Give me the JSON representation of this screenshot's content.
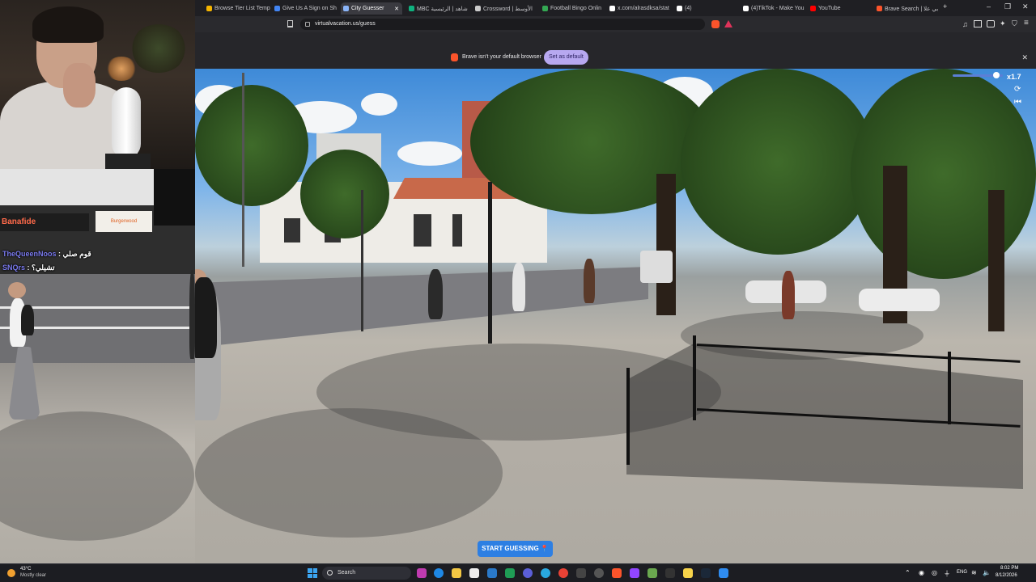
{
  "browser": {
    "tabs": [
      {
        "title": "Browse Tier List Temp",
        "favicon_color": "#f4b400"
      },
      {
        "title": "Give Us A Sign on Sh",
        "favicon_color": "#4285f4"
      },
      {
        "title": "City Guesser",
        "favicon_color": "#8ab4f8",
        "active": true
      },
      {
        "title": "MBC شاهد | الرئيسية",
        "favicon_color": "#0fb27f"
      },
      {
        "title": "Crossword | الأوسط",
        "favicon_color": "#cccccc"
      },
      {
        "title": "Football Bingo Onlin",
        "favicon_color": "#34a853"
      },
      {
        "title": "x.com/alrasdksa/stat",
        "favicon_color": "#ffffff"
      },
      {
        "title": "(4)",
        "favicon_color": "#ffffff"
      },
      {
        "title": "(4)TikTok - Make You",
        "favicon_color": "#ffffff"
      },
      {
        "title": "YouTube",
        "favicon_color": "#ff0000"
      },
      {
        "title": "Brave Search | بي علا",
        "favicon_color": "#fb542b"
      }
    ],
    "url": "virtualvacation.us/guess",
    "new_tab_symbol": "+",
    "window_controls": {
      "minimize": "–",
      "maximize": "❐",
      "close": "✕"
    }
  },
  "notice": {
    "text": "Brave isn't your default browser",
    "button": "Set as default",
    "close": "✕"
  },
  "viewer": {
    "speed_label": "x1.7",
    "speed_level": 0.8,
    "start_button": "START GUESSING 📍"
  },
  "chat": [
    {
      "user": "TheQueenNoos",
      "message": ": قوم صلي"
    },
    {
      "user": "SNQrs",
      "message": ": تشيلي؟"
    }
  ],
  "scene_signs": {
    "shop_left": "Banafide",
    "shop_right": "Burgerwood"
  },
  "taskbar": {
    "weather_temp": "43°C",
    "weather_desc": "Mostly clear",
    "search": "Search",
    "lang": "ENG",
    "time": "8:02 PM",
    "date": "8/12/2026"
  },
  "colors": {
    "accent_blue": "#2d7fe3",
    "set_default_bg": "#b7a8f0",
    "chat_user": "#7b7bf0"
  }
}
